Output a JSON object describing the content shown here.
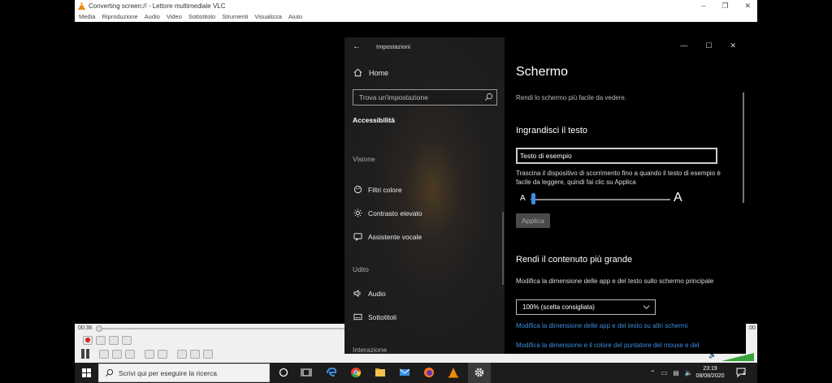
{
  "vlc": {
    "title": "Converting screen:// - Lettore multimediale VLC",
    "menu": [
      "Media",
      "Riproduzione",
      "Audio",
      "Video",
      "Sottotitolo",
      "Strumenti",
      "Visualizza",
      "Aiuto"
    ],
    "time_elapsed": "00:36",
    "time_total": ":00",
    "window_buttons": [
      "–",
      "❐",
      "✕"
    ]
  },
  "settings": {
    "app_title": "Impostazioni",
    "back_glyph": "←",
    "window_buttons": [
      "—",
      "☐",
      "✕"
    ],
    "sidebar": {
      "home": "Home",
      "search_placeholder": "Trova un'impostazione",
      "heading": "Accessibilità",
      "sections": [
        {
          "label": "Visione",
          "items": [
            "Filtri colore",
            "Contrasto elevato",
            "Assistente vocale"
          ]
        },
        {
          "label": "Udito",
          "items": [
            "Audio",
            "Sottotitoli"
          ]
        },
        {
          "label": "Interazione",
          "items": []
        }
      ]
    },
    "main": {
      "title": "Schermo",
      "subtitle": "Rendi lo schermo più facile da vedere.",
      "section1_title": "Ingrandisci il testo",
      "sample_text": "Testo di esempio",
      "slider_desc": "Trascina il dispositivo di scorrimento fino a quando il testo di esempio è facile da leggere, quindi fai clic su Applica",
      "slider_small_label": "A",
      "slider_big_label": "A",
      "slider_value": 0.02,
      "apply_label": "Applica",
      "section2_title": "Rendi il contenuto più grande",
      "scale_desc": "Modifica la dimensione delle app e del testo sullo schermo principale",
      "scale_value": "100% (scelta consigliata)",
      "link1": "Modifica la dimensione delle app e del testo su altri schermi",
      "link2": "Modifica la dimensione e il colore del puntatore del mouse e del"
    }
  },
  "taskbar": {
    "search_placeholder": "Scrivi qui per eseguire la ricerca",
    "time": "23:19",
    "date": "08/08/2020",
    "notification_count": "1"
  },
  "colors": {
    "accent": "#3a8ee6",
    "link": "#3d8ee0",
    "vlc_orange": "#f08a00"
  }
}
